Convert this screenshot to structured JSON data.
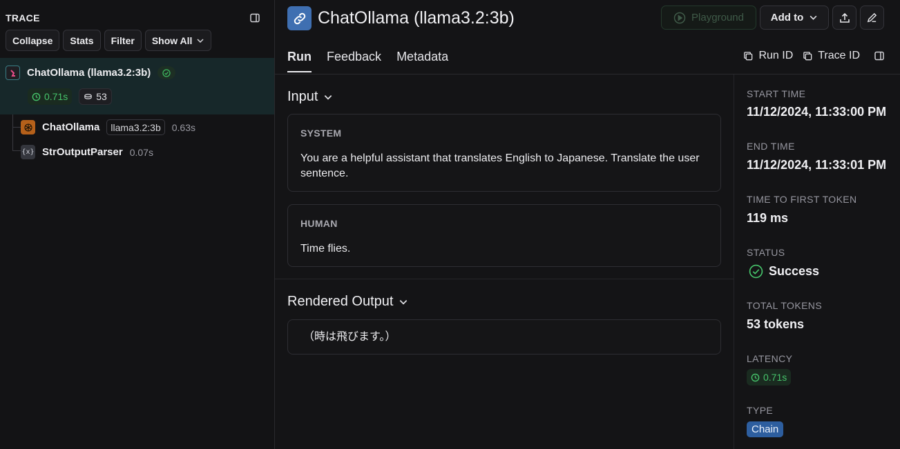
{
  "trace": {
    "title": "TRACE",
    "toolbar": {
      "collapse": "Collapse",
      "stats": "Stats",
      "filter": "Filter",
      "show_all": "Show All"
    },
    "root": {
      "name": "ChatOllama (llama3.2:3b)",
      "latency": "0.71s",
      "tokens": "53"
    },
    "children": [
      {
        "name": "ChatOllama",
        "model": "llama3.2:3b",
        "latency": "0.63s"
      },
      {
        "name": "StrOutputParser",
        "latency": "0.07s",
        "icon_text": "{x}"
      }
    ]
  },
  "header": {
    "title": "ChatOllama (llama3.2:3b)",
    "playground": "Playground",
    "add_to": "Add to"
  },
  "tabs": {
    "run": "Run",
    "feedback": "Feedback",
    "metadata": "Metadata"
  },
  "ids": {
    "run_id": "Run ID",
    "trace_id": "Trace ID"
  },
  "input": {
    "heading": "Input",
    "messages": [
      {
        "role": "SYSTEM",
        "text": "You are a helpful assistant that translates English to Japanese. Translate the user sentence."
      },
      {
        "role": "HUMAN",
        "text": "Time flies."
      }
    ]
  },
  "output": {
    "heading": "Rendered Output",
    "text": "（時は飛びます。）"
  },
  "meta": {
    "start_time_label": "START TIME",
    "start_time": "11/12/2024, 11:33:00 PM",
    "end_time_label": "END TIME",
    "end_time": "11/12/2024, 11:33:01 PM",
    "ttft_label": "TIME TO FIRST TOKEN",
    "ttft": "119 ms",
    "status_label": "STATUS",
    "status": "Success",
    "total_tokens_label": "TOTAL TOKENS",
    "total_tokens": "53 tokens",
    "latency_label": "LATENCY",
    "latency": "0.71s",
    "type_label": "TYPE",
    "type": "Chain"
  },
  "colors": {
    "accent_green": "#46c46b",
    "title_icon_blue": "#3f6fb1",
    "badge_blue": "#2d5e9f",
    "selected_row": "#17282a"
  }
}
